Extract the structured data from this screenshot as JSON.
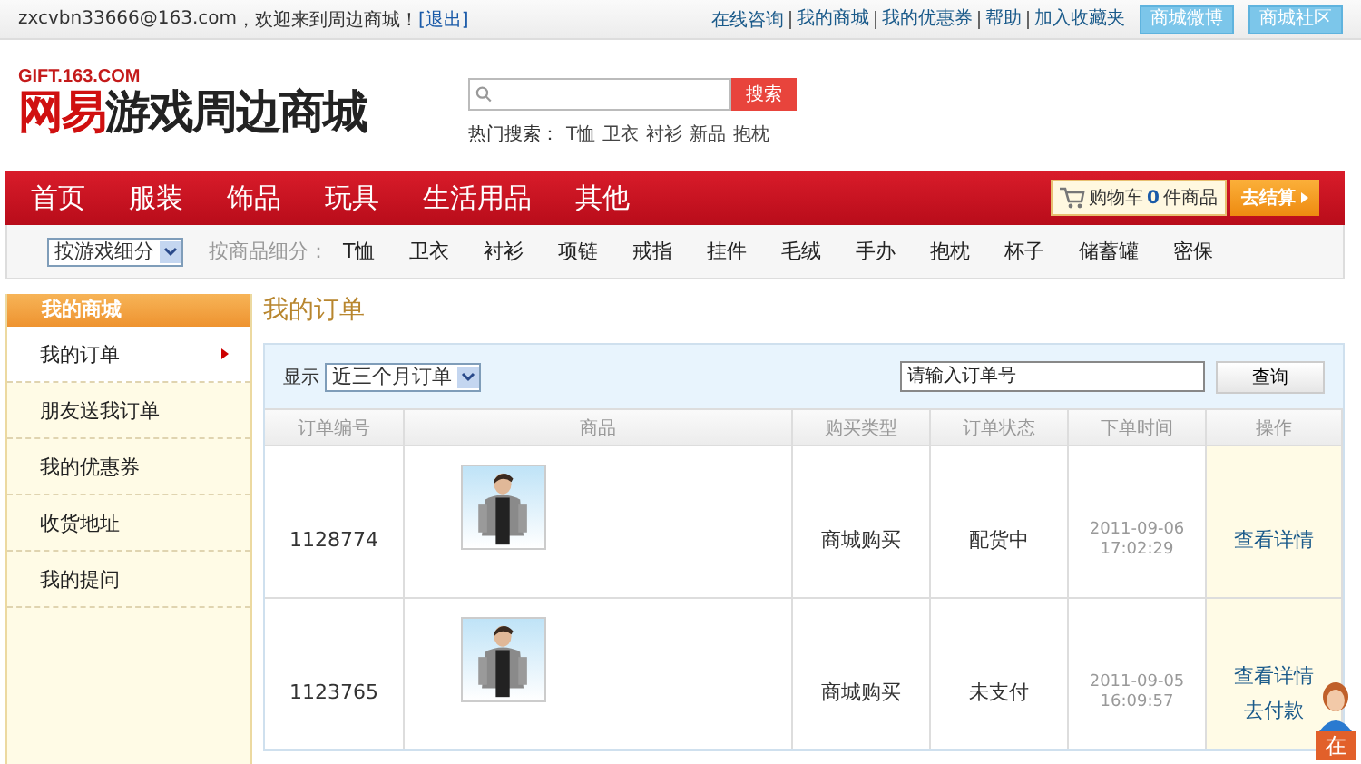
{
  "top_bar": {
    "user": "zxcvbn33666@163.com",
    "welcome": "，欢迎来到周边商城！",
    "logout": "[退出]",
    "links": [
      "在线咨询",
      "我的商城",
      "我的优惠券",
      "帮助",
      "加入收藏夹"
    ],
    "buttons": [
      "商城微博",
      "商城社区"
    ]
  },
  "header": {
    "logo_small": "GIFT.163.COM",
    "logo_red": "网易",
    "logo_dark": "游戏周边商城",
    "search": {
      "button": "搜索"
    },
    "hot_label": "热门搜索：",
    "hot": [
      "T恤",
      "卫衣",
      "衬衫",
      "新品",
      "抱枕"
    ]
  },
  "nav": {
    "items": [
      "首页",
      "服装",
      "饰品",
      "玩具",
      "生活用品",
      "其他"
    ],
    "cart_label": "购物车",
    "cart_count": "0",
    "cart_unit": "件商品",
    "checkout": "去结算"
  },
  "sub_nav": {
    "select": "按游戏细分",
    "label": "按商品细分：",
    "items": [
      "T恤",
      "卫衣",
      "衬衫",
      "项链",
      "戒指",
      "挂件",
      "毛绒",
      "手办",
      "抱枕",
      "杯子",
      "储蓄罐",
      "密保"
    ]
  },
  "sidebar": {
    "title": "我的商城",
    "items": [
      {
        "label": "我的订单",
        "selected": true
      },
      {
        "label": "朋友送我订单",
        "selected": false
      },
      {
        "label": "我的优惠券",
        "selected": false
      },
      {
        "label": "收货地址",
        "selected": false
      },
      {
        "label": "我的提问",
        "selected": false
      }
    ]
  },
  "main": {
    "title": "我的订单",
    "filter_label": "显示",
    "filter_value": "近三个月订单",
    "order_placeholder": "请输入订单号",
    "query_button": "查询",
    "table": {
      "columns": [
        "订单编号",
        "商品",
        "购买类型",
        "订单状态",
        "下单时间",
        "操作"
      ],
      "rows": [
        {
          "id": "1128774",
          "product": {
            "kind": "picture"
          },
          "type": "商城购买",
          "status": "配货中",
          "date": "2011-09-06",
          "time": "17:02:29",
          "actions": [
            "查看详情"
          ]
        },
        {
          "id": "1123765",
          "product": {
            "kind": "picture"
          },
          "type": "商城购买",
          "status": "未支付",
          "date": "2011-09-05",
          "time": "16:09:57",
          "actions": [
            "查看详情",
            "去付款"
          ]
        }
      ]
    }
  },
  "support_widget": {
    "text": "在"
  }
}
